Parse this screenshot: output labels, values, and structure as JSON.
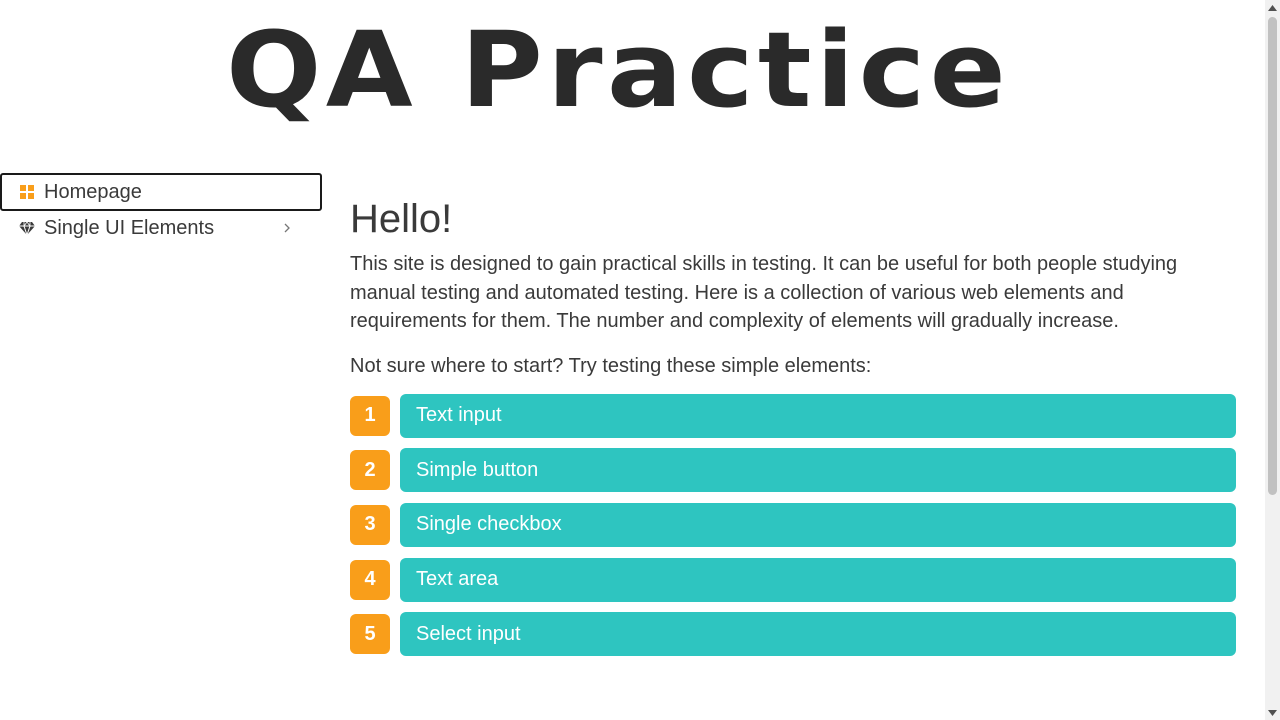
{
  "header": {
    "logo_text": "QA Practice"
  },
  "sidebar": {
    "items": [
      {
        "label": "Homepage",
        "icon": "grid-icon",
        "active": true
      },
      {
        "label": "Single UI Elements",
        "icon": "diamond-icon",
        "has_submenu": true
      }
    ]
  },
  "main": {
    "title": "Hello!",
    "intro": "This site is designed to gain practical skills in testing. It can be useful for both people studying manual testing and automated testing. Here is a collection of various web elements and requirements for them. The number and complexity of elements will gradually increase.",
    "prompt": "Not sure where to start? Try testing these simple elements:",
    "elements": [
      {
        "number": "1",
        "label": "Text input"
      },
      {
        "number": "2",
        "label": "Simple button"
      },
      {
        "number": "3",
        "label": "Single checkbox"
      },
      {
        "number": "4",
        "label": "Text area"
      },
      {
        "number": "5",
        "label": "Select input"
      }
    ]
  },
  "colors": {
    "accent_orange": "#f99e1a",
    "accent_teal": "#2ec5c0",
    "text": "#3a3a3a"
  }
}
